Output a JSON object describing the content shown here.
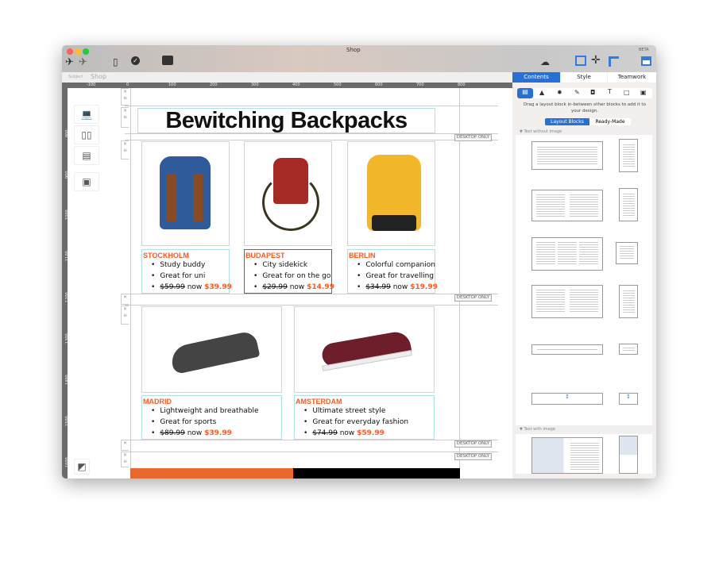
{
  "window": {
    "title": "Shop",
    "beta": "BETA"
  },
  "subject": {
    "label": "Subject",
    "value": "Shop"
  },
  "ruler": {
    "h": [
      "-100",
      "0",
      "100",
      "200",
      "300",
      "400",
      "500",
      "600",
      "700",
      "800"
    ],
    "v": [
      "800",
      "900",
      "1000",
      "1100",
      "1200",
      "1300",
      "1400",
      "1500",
      "1600"
    ]
  },
  "page": {
    "title": "Bewitching Backpacks",
    "badge": "DESKTOP ONLY",
    "row1": [
      {
        "city": "STOCKHOLM",
        "items": [
          "Study buddy",
          "Great for uni"
        ],
        "old": "$59.99",
        "now": "now",
        "new": "$39.99",
        "color": "#2f5b9a"
      },
      {
        "city": "BUDAPEST",
        "items": [
          "City sidekick",
          "Great for on the go"
        ],
        "old": "$29.99",
        "now": "now",
        "new": "$14.99",
        "color": "#a52a25"
      },
      {
        "city": "BERLIN",
        "items": [
          "Colorful companion",
          "Great for travelling"
        ],
        "old": "$34.99",
        "now": "now",
        "new": "$19.99",
        "color": "#f2b72a"
      }
    ],
    "row2": [
      {
        "city": "MADRID",
        "items": [
          "Lightweight and breathable",
          "Great for sports"
        ],
        "old": "$89.99",
        "now": "now",
        "new": "$39.99",
        "color": "#444"
      },
      {
        "city": "AMSTERDAM",
        "items": [
          "Ultimate street style",
          "Great for everyday fashion"
        ],
        "old": "$74.99",
        "now": "now",
        "new": "$59.99",
        "color": "#6e1d2a"
      }
    ]
  },
  "sidebar": {
    "tabs": [
      "Contents",
      "Style",
      "Teamwork"
    ],
    "hint": "Drag a layout block in-between other blocks to add it to your design.",
    "segments": [
      "Layout Blocks",
      "Ready-Made"
    ],
    "sections": [
      "Text without image",
      "Text with image"
    ]
  },
  "colors": {
    "accent": "#2670d6",
    "price": "#ff5a1f"
  }
}
